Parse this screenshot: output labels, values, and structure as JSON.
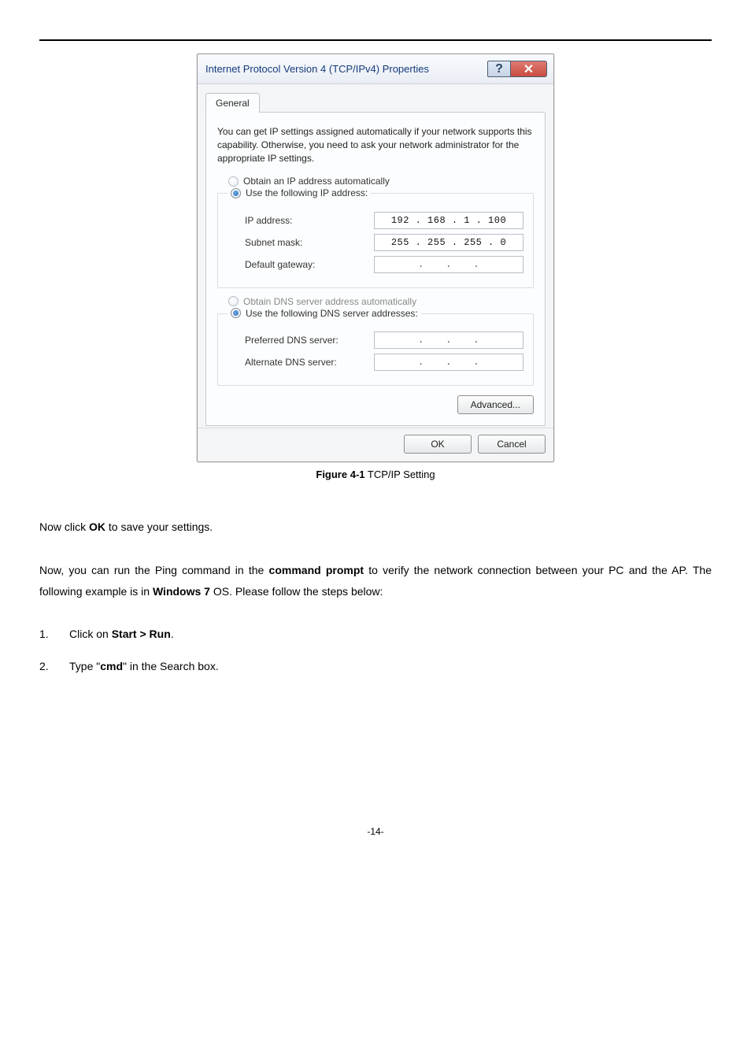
{
  "dialog": {
    "title": "Internet Protocol Version 4 (TCP/IPv4) Properties",
    "help_glyph": "?",
    "close_glyph": "✕",
    "tab": "General",
    "description": "You can get IP settings assigned automatically if your network supports this capability. Otherwise, you need to ask your network administrator for the appropriate IP settings.",
    "ip_group": {
      "opt_auto": "Obtain an IP address automatically",
      "opt_manual": "Use the following IP address:",
      "ip_label": "IP address:",
      "ip_value": "192 . 168 .  1  . 100",
      "mask_label": "Subnet mask:",
      "mask_value": "255 . 255 . 255 .  0",
      "gw_label": "Default gateway:"
    },
    "dns_group": {
      "opt_auto": "Obtain DNS server address automatically",
      "opt_manual": "Use the following DNS server addresses:",
      "pref_label": "Preferred DNS server:",
      "alt_label": "Alternate DNS server:"
    },
    "advanced_btn": "Advanced...",
    "ok_btn": "OK",
    "cancel_btn": "Cancel"
  },
  "caption": {
    "figure": "Figure 4-1",
    "text": " TCP/IP Setting"
  },
  "body": {
    "p1a": "Now click ",
    "p1b": "OK",
    "p1c": " to save your settings.",
    "p2a": "Now, you can run the Ping command in the ",
    "p2b": "command prompt",
    "p2c": " to verify the network connection between your PC and the AP. The following example is in ",
    "p2d": "Windows 7",
    "p2e": " OS. Please follow the steps below:",
    "li1_num": "1.",
    "li1a": "Click on ",
    "li1b": "Start > Run",
    "li1c": ".",
    "li2_num": "2.",
    "li2a": "Type \"",
    "li2b": "cmd",
    "li2c": "\" in the Search box."
  },
  "page_number": "-14-"
}
